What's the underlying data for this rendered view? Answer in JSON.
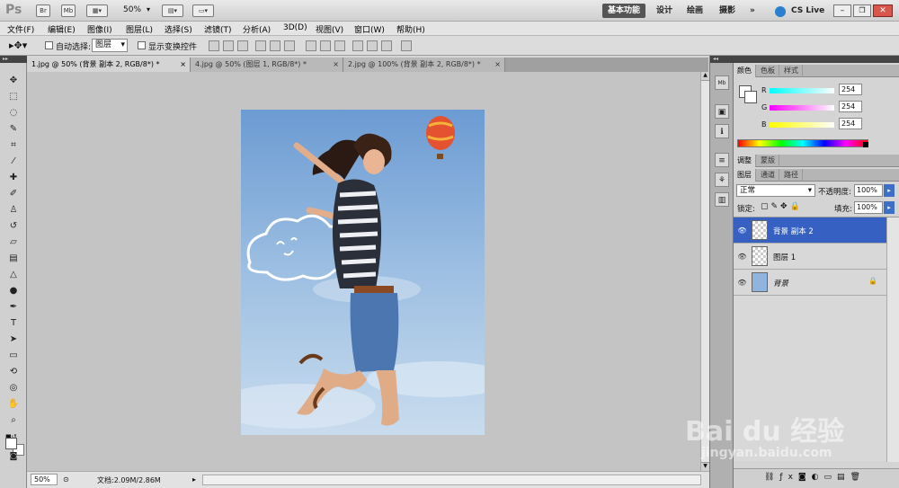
{
  "app": {
    "logo": "Ps",
    "bridge": "Br",
    "minibridge": "Mb",
    "zoom": "50%"
  },
  "workspaces": {
    "essentials": "基本功能",
    "design": "设计",
    "painting": "绘画",
    "photography": "摄影",
    "more": "»",
    "cs_live": "CS Live"
  },
  "menu": [
    "文件(F)",
    "编辑(E)",
    "图像(I)",
    "图层(L)",
    "选择(S)",
    "滤镜(T)",
    "分析(A)",
    "3D(D)",
    "视图(V)",
    "窗口(W)",
    "帮助(H)"
  ],
  "options": {
    "auto_select_label": "自动选择:",
    "auto_select_value": "图层",
    "show_transform_label": "显示变换控件"
  },
  "tabs": [
    {
      "label": "1.jpg @ 50% (背景 副本 2, RGB/8*) *",
      "close": "×"
    },
    {
      "label": "4.jpg @ 50% (图层 1, RGB/8*) *",
      "close": "×"
    },
    {
      "label": "2.jpg @ 100% (背景 副本 2, RGB/8*) *",
      "close": "×"
    }
  ],
  "status": {
    "zoom": "50%",
    "doc": "文档:2.09M/2.86M"
  },
  "color_panel": {
    "tabs": [
      "颜色",
      "色板",
      "样式"
    ],
    "r_label": "R",
    "g_label": "G",
    "b_label": "B",
    "r": "254",
    "g": "254",
    "b": "254"
  },
  "adjust_panel": {
    "tabs": [
      "调整",
      "蒙版"
    ]
  },
  "layers_panel": {
    "tabs": [
      "图层",
      "通道",
      "路径"
    ],
    "blend_mode": "正常",
    "opacity_label": "不透明度:",
    "opacity": "100%",
    "lock_label": "锁定:",
    "fill_label": "填充:",
    "fill": "100%",
    "layers": [
      {
        "name": "背景 副本 2",
        "selected": true
      },
      {
        "name": "图层 1",
        "selected": false
      },
      {
        "name": "背景",
        "selected": false
      }
    ]
  },
  "watermark": {
    "brand": "Bai du 经验",
    "url": "jingyan.baidu.com"
  },
  "colors": {
    "selection": "#3661c3",
    "sky": "#8fb5de"
  }
}
